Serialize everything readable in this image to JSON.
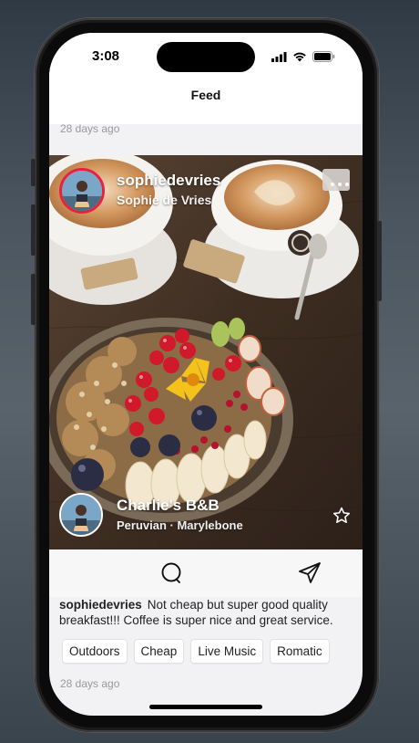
{
  "status": {
    "time": "3:08"
  },
  "nav": {
    "title": "Feed"
  },
  "prev_post": {
    "timestamp": "28 days ago"
  },
  "post": {
    "author": {
      "username": "sophiedevries",
      "full_name": "Sophie de Vries"
    },
    "place": {
      "name": "Charlie's B&B",
      "subtitle": "Peruvian · Marylebone"
    },
    "caption": {
      "username": "sophiedevries",
      "text": "Not cheap but super good quality breakfast!!! Coffee is super nice and great service."
    },
    "tags": [
      "Outdoors",
      "Cheap",
      "Live Music",
      "Romatic"
    ],
    "timestamp": "28 days ago"
  },
  "icons": {
    "more": "ellipsis-icon",
    "favorite": "star-icon",
    "comment": "comment-bubble-icon",
    "share": "paper-plane-icon"
  },
  "colors": {
    "story_ring": "#e8213f",
    "background": "#f2f2f4"
  }
}
